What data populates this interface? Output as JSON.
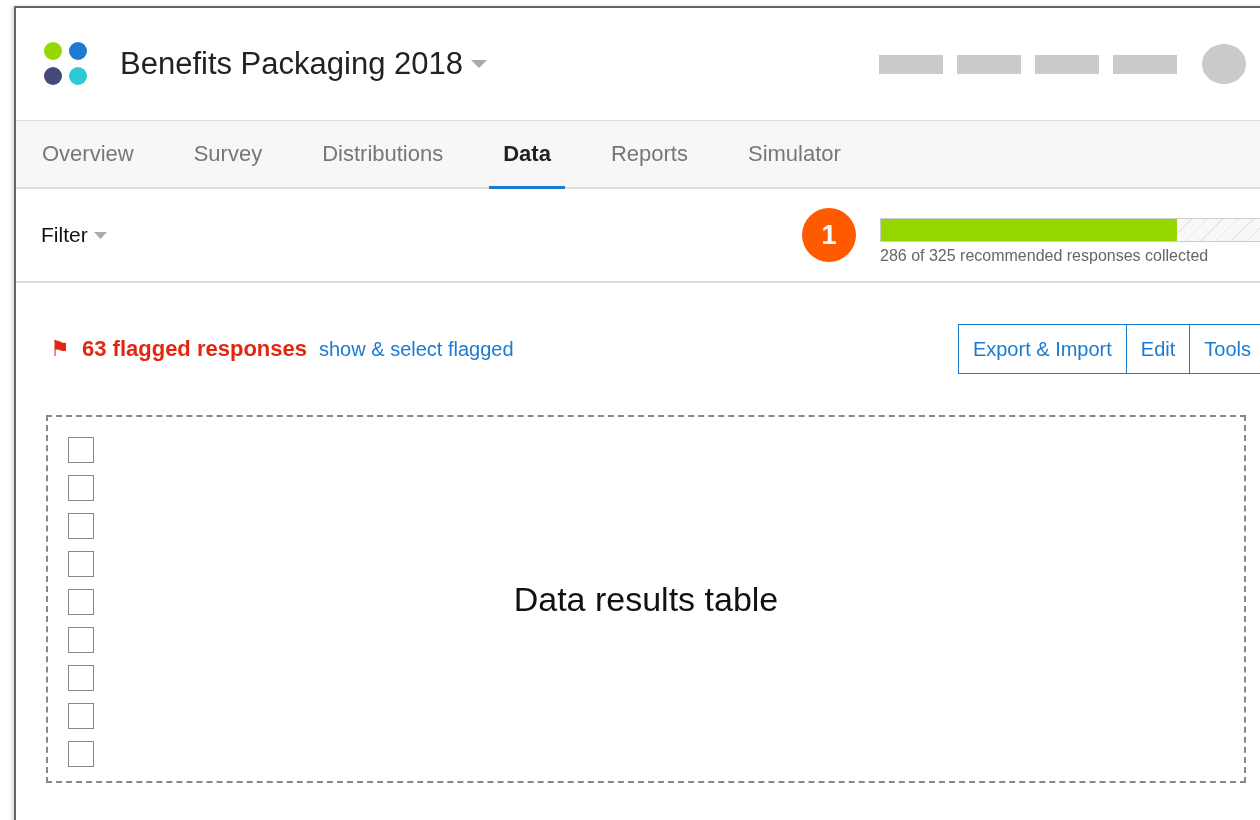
{
  "project": {
    "title": "Benefits Packaging 2018"
  },
  "tabs": [
    {
      "label": "Overview",
      "selected": false
    },
    {
      "label": "Survey",
      "selected": false
    },
    {
      "label": "Distributions",
      "selected": false
    },
    {
      "label": "Data",
      "selected": true
    },
    {
      "label": "Reports",
      "selected": false
    },
    {
      "label": "Simulator",
      "selected": false
    }
  ],
  "filter": {
    "label": "Filter"
  },
  "quota": {
    "badge": "1",
    "level": 0.78,
    "caption": "286 of 325 recommended responses collected"
  },
  "flagged": {
    "icon": "⚑",
    "count_text": "63 flagged responses",
    "link": "show & select flagged"
  },
  "actions": [
    "Export & Import",
    "Edit",
    "Tools"
  ],
  "table": {
    "label": "Data results table",
    "rows": [
      {
        "checked": false
      },
      {
        "checked": false
      },
      {
        "checked": false
      },
      {
        "checked": false
      },
      {
        "checked": false
      },
      {
        "checked": false
      },
      {
        "checked": false
      },
      {
        "checked": false
      },
      {
        "checked": false
      }
    ]
  }
}
